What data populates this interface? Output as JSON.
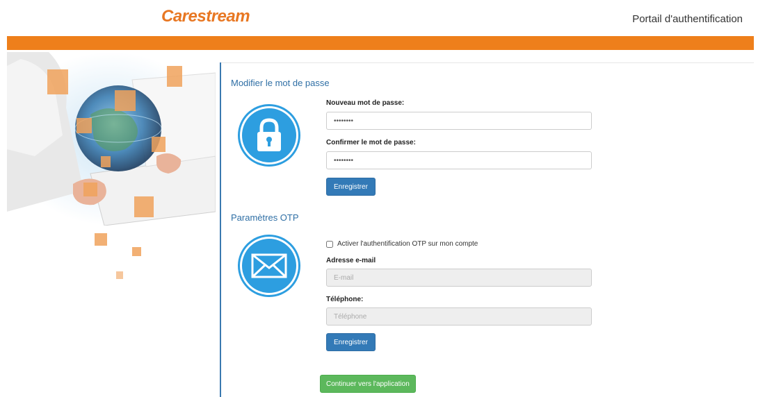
{
  "header": {
    "logo_text": "Carestream",
    "portal_title": "Portail d'authentification"
  },
  "colors": {
    "brand_orange": "#ee7f1b",
    "primary_blue": "#337ab7",
    "success_green": "#5cb85c",
    "icon_blue": "#2d9ee0"
  },
  "password_section": {
    "title": "Modifier le mot de passe",
    "icon": "padlock-icon",
    "new_password_label": "Nouveau mot de passe:",
    "new_password_value": "••••••••",
    "confirm_password_label": "Confirmer le mot de passe:",
    "confirm_password_value": "••••••••",
    "save_label": "Enregistrer"
  },
  "otp_section": {
    "title": "Paramètres OTP",
    "icon": "envelope-icon",
    "enable_otp_label": "Activer l'authentification OTP sur mon compte",
    "email_label": "Adresse e-mail",
    "email_placeholder": "E-mail",
    "phone_label": "Téléphone:",
    "phone_placeholder": "Téléphone",
    "save_label": "Enregistrer"
  },
  "continue_label": "Continuer vers l'application"
}
